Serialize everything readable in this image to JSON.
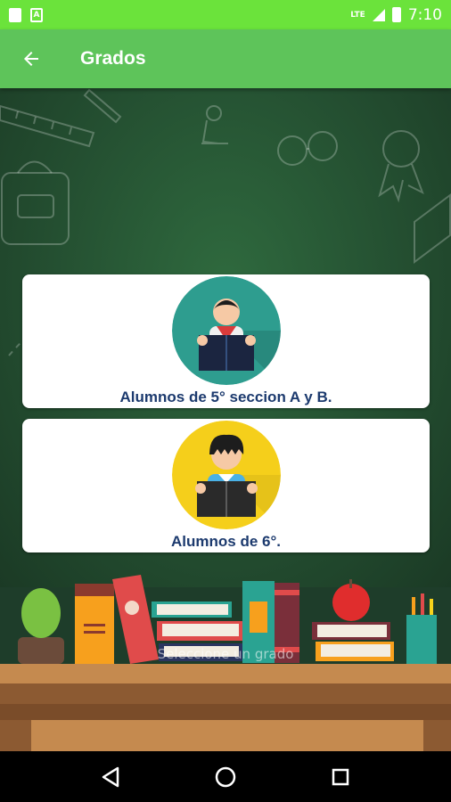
{
  "status_bar": {
    "lte": "LTE",
    "time": "7:10"
  },
  "app_bar": {
    "title": "Grados"
  },
  "cards": [
    {
      "label": "Alumnos de 5° seccion A y B.",
      "avatar_color": "#2e9d8f"
    },
    {
      "label": "Alumnos de 6°.",
      "avatar_color": "#f5cf1b"
    }
  ],
  "toast": {
    "text": "Seleccione un grado"
  },
  "colors": {
    "status_bar": "#6be33b",
    "app_bar": "#5ec45a",
    "label": "#1c3a6e"
  },
  "nav": {
    "back_icon": "triangle-back-icon",
    "home_icon": "circle-home-icon",
    "recents_icon": "square-recents-icon"
  }
}
